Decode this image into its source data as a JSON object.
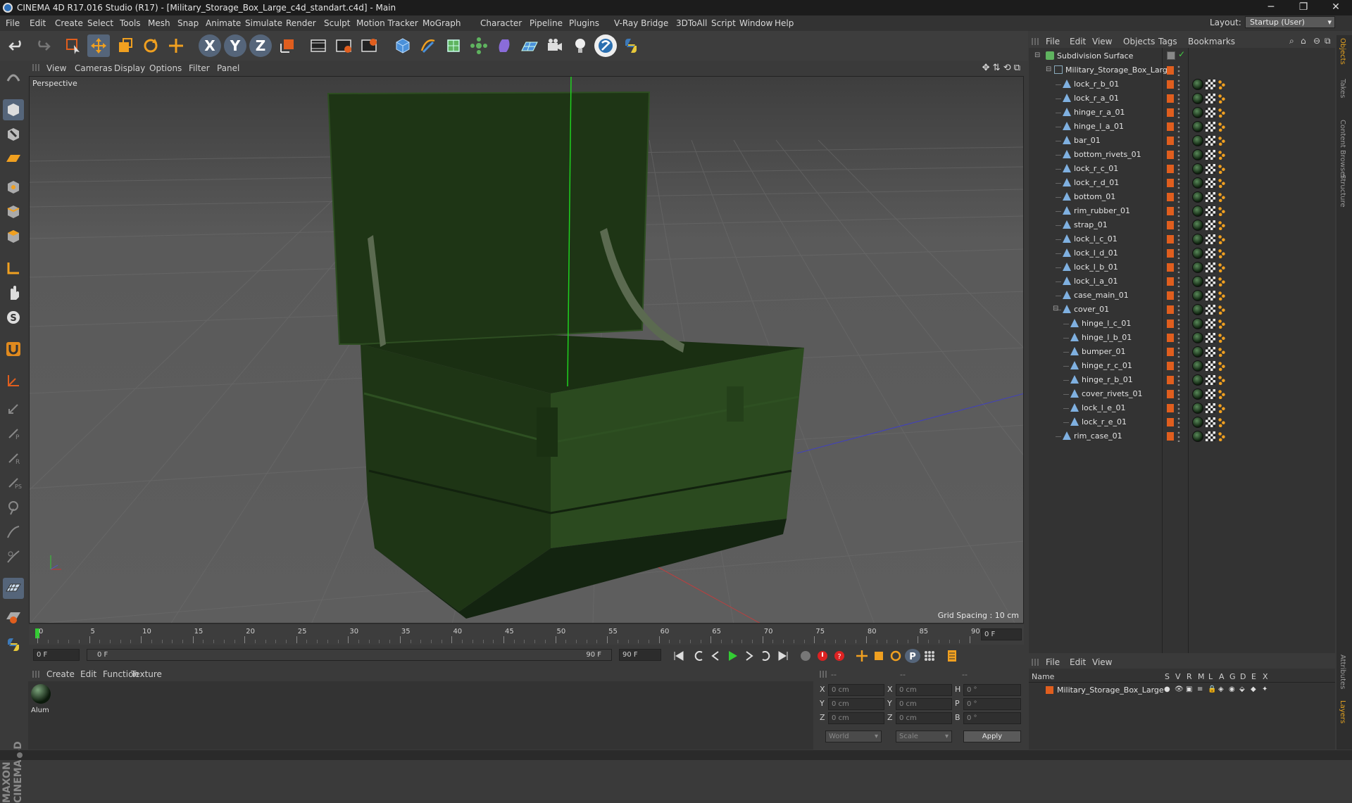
{
  "window": {
    "title": "CINEMA 4D R17.016 Studio (R17) - [Military_Storage_Box_Large_c4d_standart.c4d] - Main",
    "minimize": "─",
    "maximize": "❐",
    "close": "✕"
  },
  "menubar": {
    "items": [
      "File",
      "Edit",
      "Create",
      "Select",
      "Tools",
      "Mesh",
      "Snap",
      "Animate",
      "Simulate",
      "Render",
      "Sculpt",
      "Motion Tracker",
      "MoGraph",
      "Character",
      "Pipeline",
      "Plugins",
      "V-Ray Bridge",
      "3DToAll",
      "Script",
      "Window",
      "Help"
    ],
    "layout_label": "Layout:",
    "layout_value": "Startup (User)"
  },
  "toolbar": {
    "icons": [
      "undo-icon",
      "redo-icon",
      "live-selection-icon",
      "move-icon",
      "scale-icon",
      "rotate-icon",
      "last-tool-icon",
      "x-axis-icon",
      "y-axis-icon",
      "z-axis-icon",
      "coordinate-system-icon",
      "render-view-icon",
      "render-picture-viewer-icon",
      "edit-render-settings-icon",
      "cube-primitive-icon",
      "spline-pen-icon",
      "subdivision-surface-icon",
      "array-icon",
      "deformer-icon",
      "floor-icon",
      "camera-icon",
      "light-icon",
      "material-icon",
      "python-icon"
    ],
    "axis_labels": [
      "X",
      "Y",
      "Z"
    ]
  },
  "viewport_menu": {
    "items": [
      "View",
      "Cameras",
      "Display",
      "Options",
      "Filter",
      "Panel"
    ]
  },
  "viewport": {
    "label": "Perspective",
    "grid_spacing": "Grid Spacing : 10 cm",
    "box_color": "#1e3515",
    "box_dark": "#132410",
    "box_light": "#2c4a20"
  },
  "timeline": {
    "ticks": [
      "0",
      "5",
      "10",
      "15",
      "20",
      "25",
      "30",
      "35",
      "40",
      "45",
      "50",
      "55",
      "60",
      "65",
      "70",
      "75",
      "80",
      "85",
      "90"
    ],
    "current_frame_field": "0 F"
  },
  "transport": {
    "start_field": "0 F",
    "range_start": "0 F",
    "range_end": "90 F",
    "end_field": "90 F"
  },
  "material_menu": {
    "items": [
      "Create",
      "Edit",
      "Function",
      "Texture"
    ]
  },
  "materials": [
    {
      "name": "Alum"
    }
  ],
  "coordinates": {
    "header_a": "--",
    "header_b": "--",
    "header_c": "--",
    "rows": [
      {
        "axis": "X",
        "pos": "0 cm",
        "axis2": "X",
        "size": "0 cm",
        "rot_label": "H",
        "rot": "0 °"
      },
      {
        "axis": "Y",
        "pos": "0 cm",
        "axis2": "Y",
        "size": "0 cm",
        "rot_label": "P",
        "rot": "0 °"
      },
      {
        "axis": "Z",
        "pos": "0 cm",
        "axis2": "Z",
        "size": "0 cm",
        "rot_label": "B",
        "rot": "0 °"
      }
    ],
    "mode_select": "World",
    "scale_select": "Scale",
    "apply": "Apply"
  },
  "object_manager": {
    "menu": [
      "File",
      "Edit",
      "View",
      "Objects",
      "Tags",
      "Bookmarks"
    ],
    "objects": [
      {
        "name": "Subdivision Surface",
        "level": 0,
        "kind": "subdiv"
      },
      {
        "name": "Military_Storage_Box_Large",
        "level": 1,
        "kind": "null"
      },
      {
        "name": "lock_r_b_01",
        "level": 2,
        "kind": "poly"
      },
      {
        "name": "lock_r_a_01",
        "level": 2,
        "kind": "poly"
      },
      {
        "name": "hinge_r_a_01",
        "level": 2,
        "kind": "poly"
      },
      {
        "name": "hinge_l_a_01",
        "level": 2,
        "kind": "poly"
      },
      {
        "name": "bar_01",
        "level": 2,
        "kind": "poly"
      },
      {
        "name": "bottom_rivets_01",
        "level": 2,
        "kind": "poly"
      },
      {
        "name": "lock_r_c_01",
        "level": 2,
        "kind": "poly"
      },
      {
        "name": "lock_r_d_01",
        "level": 2,
        "kind": "poly"
      },
      {
        "name": "bottom_01",
        "level": 2,
        "kind": "poly"
      },
      {
        "name": "rim_rubber_01",
        "level": 2,
        "kind": "poly"
      },
      {
        "name": "strap_01",
        "level": 2,
        "kind": "poly"
      },
      {
        "name": "lock_l_c_01",
        "level": 2,
        "kind": "poly"
      },
      {
        "name": "lock_l_d_01",
        "level": 2,
        "kind": "poly"
      },
      {
        "name": "lock_l_b_01",
        "level": 2,
        "kind": "poly"
      },
      {
        "name": "lock_l_a_01",
        "level": 2,
        "kind": "poly"
      },
      {
        "name": "case_main_01",
        "level": 2,
        "kind": "poly"
      },
      {
        "name": "cover_01",
        "level": 2,
        "kind": "poly",
        "expanded": true
      },
      {
        "name": "hinge_l_c_01",
        "level": 3,
        "kind": "poly"
      },
      {
        "name": "hinge_l_b_01",
        "level": 3,
        "kind": "poly"
      },
      {
        "name": "bumper_01",
        "level": 3,
        "kind": "poly"
      },
      {
        "name": "hinge_r_c_01",
        "level": 3,
        "kind": "poly"
      },
      {
        "name": "hinge_r_b_01",
        "level": 3,
        "kind": "poly"
      },
      {
        "name": "cover_rivets_01",
        "level": 3,
        "kind": "poly"
      },
      {
        "name": "lock_l_e_01",
        "level": 3,
        "kind": "poly"
      },
      {
        "name": "lock_r_e_01",
        "level": 3,
        "kind": "poly"
      },
      {
        "name": "rim_case_01",
        "level": 2,
        "kind": "poly"
      }
    ]
  },
  "layer_manager": {
    "menu": [
      "File",
      "Edit",
      "View"
    ],
    "columns": [
      "Name",
      "S",
      "V",
      "R",
      "M",
      "L",
      "A",
      "G",
      "D",
      "E",
      "X"
    ],
    "layers": [
      {
        "name": "Military_Storage_Box_Large",
        "color": "#e05e1e"
      }
    ]
  },
  "side_tabs": [
    "Objects",
    "Takes",
    "Content Browser",
    "Structure"
  ],
  "side_tabs_bottom": [
    "Attributes",
    "Layers"
  ],
  "accent": "#e05e1e"
}
